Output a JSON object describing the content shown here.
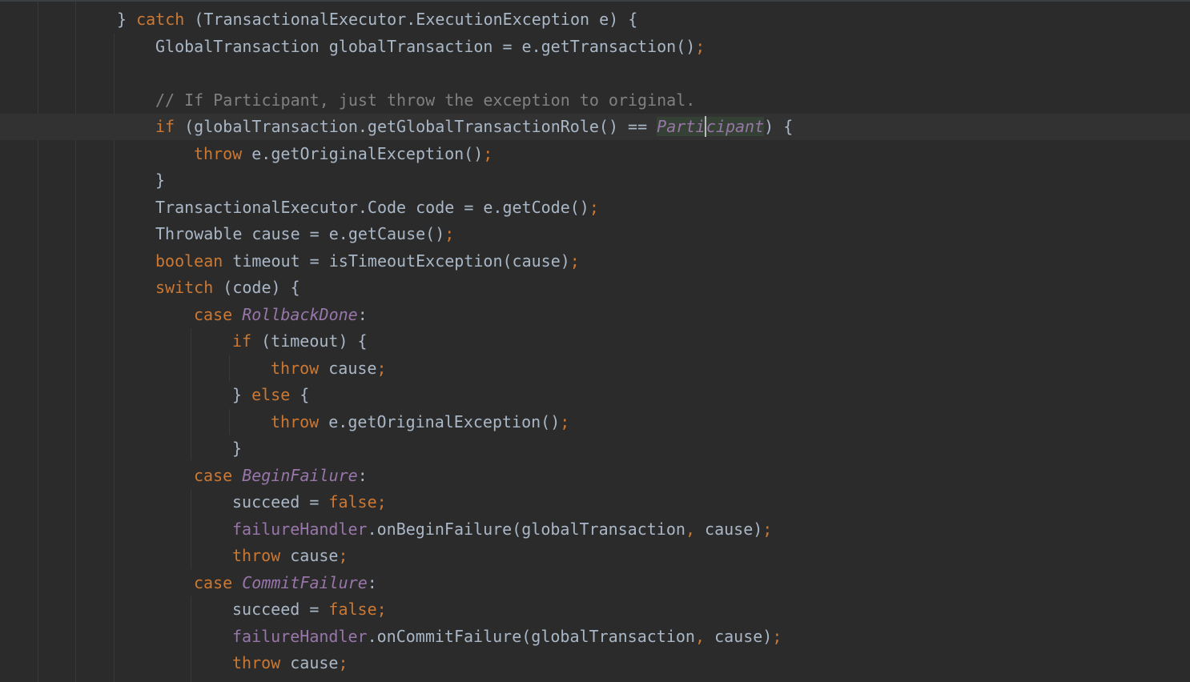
{
  "editor": {
    "lines": [
      {
        "indent": 3,
        "tokens": [
          {
            "t": "} ",
            "c": "plain"
          },
          {
            "t": "catch",
            "c": "kw"
          },
          {
            "t": " (TransactionalExecutor.ExecutionException e) {",
            "c": "plain"
          }
        ]
      },
      {
        "indent": 4,
        "tokens": [
          {
            "t": "GlobalTransaction globalTransaction = e.getTransaction()",
            "c": "plain"
          },
          {
            "t": ";",
            "c": "punc"
          }
        ]
      },
      {
        "indent": 0,
        "tokens": []
      },
      {
        "indent": 4,
        "tokens": [
          {
            "t": "// If Participant, just throw the exception to original.",
            "c": "cmt"
          }
        ]
      },
      {
        "indent": 4,
        "caret": true,
        "tokens": [
          {
            "t": "if",
            "c": "kw"
          },
          {
            "t": " (globalTransaction.getGlobalTransactionRole() == ",
            "c": "plain"
          },
          {
            "t": "Parti",
            "c": "const hl"
          },
          {
            "t": "|",
            "c": "caret"
          },
          {
            "t": "cipant",
            "c": "const hl"
          },
          {
            "t": ") {",
            "c": "plain"
          }
        ]
      },
      {
        "indent": 5,
        "tokens": [
          {
            "t": "throw",
            "c": "kw"
          },
          {
            "t": " e.getOriginalException()",
            "c": "plain"
          },
          {
            "t": ";",
            "c": "punc"
          }
        ]
      },
      {
        "indent": 4,
        "tokens": [
          {
            "t": "}",
            "c": "plain"
          }
        ]
      },
      {
        "indent": 4,
        "tokens": [
          {
            "t": "TransactionalExecutor.Code code = e.getCode()",
            "c": "plain"
          },
          {
            "t": ";",
            "c": "punc"
          }
        ]
      },
      {
        "indent": 4,
        "tokens": [
          {
            "t": "Throwable cause = e.getCause()",
            "c": "plain"
          },
          {
            "t": ";",
            "c": "punc"
          }
        ]
      },
      {
        "indent": 4,
        "tokens": [
          {
            "t": "boolean",
            "c": "kw"
          },
          {
            "t": " timeout = isTimeoutException(cause)",
            "c": "plain"
          },
          {
            "t": ";",
            "c": "punc"
          }
        ]
      },
      {
        "indent": 4,
        "tokens": [
          {
            "t": "switch",
            "c": "kw"
          },
          {
            "t": " (code) {",
            "c": "plain"
          }
        ]
      },
      {
        "indent": 5,
        "tokens": [
          {
            "t": "case",
            "c": "kw"
          },
          {
            "t": " ",
            "c": "plain"
          },
          {
            "t": "RollbackDone",
            "c": "const"
          },
          {
            "t": ":",
            "c": "plain"
          }
        ]
      },
      {
        "indent": 6,
        "tokens": [
          {
            "t": "if",
            "c": "kw"
          },
          {
            "t": " (timeout) {",
            "c": "plain"
          }
        ]
      },
      {
        "indent": 7,
        "tokens": [
          {
            "t": "throw",
            "c": "kw"
          },
          {
            "t": " cause",
            "c": "plain"
          },
          {
            "t": ";",
            "c": "punc"
          }
        ]
      },
      {
        "indent": 6,
        "tokens": [
          {
            "t": "} ",
            "c": "plain"
          },
          {
            "t": "else",
            "c": "kw"
          },
          {
            "t": " {",
            "c": "plain"
          }
        ]
      },
      {
        "indent": 7,
        "tokens": [
          {
            "t": "throw",
            "c": "kw"
          },
          {
            "t": " e.getOriginalException()",
            "c": "plain"
          },
          {
            "t": ";",
            "c": "punc"
          }
        ]
      },
      {
        "indent": 6,
        "tokens": [
          {
            "t": "}",
            "c": "plain"
          }
        ]
      },
      {
        "indent": 5,
        "tokens": [
          {
            "t": "case",
            "c": "kw"
          },
          {
            "t": " ",
            "c": "plain"
          },
          {
            "t": "BeginFailure",
            "c": "const"
          },
          {
            "t": ":",
            "c": "plain"
          }
        ]
      },
      {
        "indent": 6,
        "tokens": [
          {
            "t": "succeed = ",
            "c": "plain"
          },
          {
            "t": "false;",
            "c": "kw"
          }
        ]
      },
      {
        "indent": 6,
        "tokens": [
          {
            "t": "failureHandler",
            "c": "field"
          },
          {
            "t": ".onBeginFailure(globalTransaction",
            "c": "plain"
          },
          {
            "t": ",",
            "c": "punc"
          },
          {
            "t": " cause)",
            "c": "plain"
          },
          {
            "t": ";",
            "c": "punc"
          }
        ]
      },
      {
        "indent": 6,
        "tokens": [
          {
            "t": "throw",
            "c": "kw"
          },
          {
            "t": " cause",
            "c": "plain"
          },
          {
            "t": ";",
            "c": "punc"
          }
        ]
      },
      {
        "indent": 5,
        "tokens": [
          {
            "t": "case",
            "c": "kw"
          },
          {
            "t": " ",
            "c": "plain"
          },
          {
            "t": "CommitFailure",
            "c": "const"
          },
          {
            "t": ":",
            "c": "plain"
          }
        ]
      },
      {
        "indent": 6,
        "tokens": [
          {
            "t": "succeed = ",
            "c": "plain"
          },
          {
            "t": "false;",
            "c": "kw"
          }
        ]
      },
      {
        "indent": 6,
        "tokens": [
          {
            "t": "failureHandler",
            "c": "field"
          },
          {
            "t": ".onCommitFailure(globalTransaction",
            "c": "plain"
          },
          {
            "t": ",",
            "c": "punc"
          },
          {
            "t": " cause)",
            "c": "plain"
          },
          {
            "t": ";",
            "c": "punc"
          }
        ]
      },
      {
        "indent": 6,
        "tokens": [
          {
            "t": "throw",
            "c": "kw"
          },
          {
            "t": " cause",
            "c": "plain"
          },
          {
            "t": ";",
            "c": "punc"
          }
        ]
      }
    ]
  },
  "colors": {
    "background": "#2b2b2b",
    "keyword": "#cc7832",
    "text": "#a9b7c6",
    "comment": "#808080",
    "constant": "#9876aa",
    "caret_row": "#323232",
    "highlight": "#344134"
  }
}
